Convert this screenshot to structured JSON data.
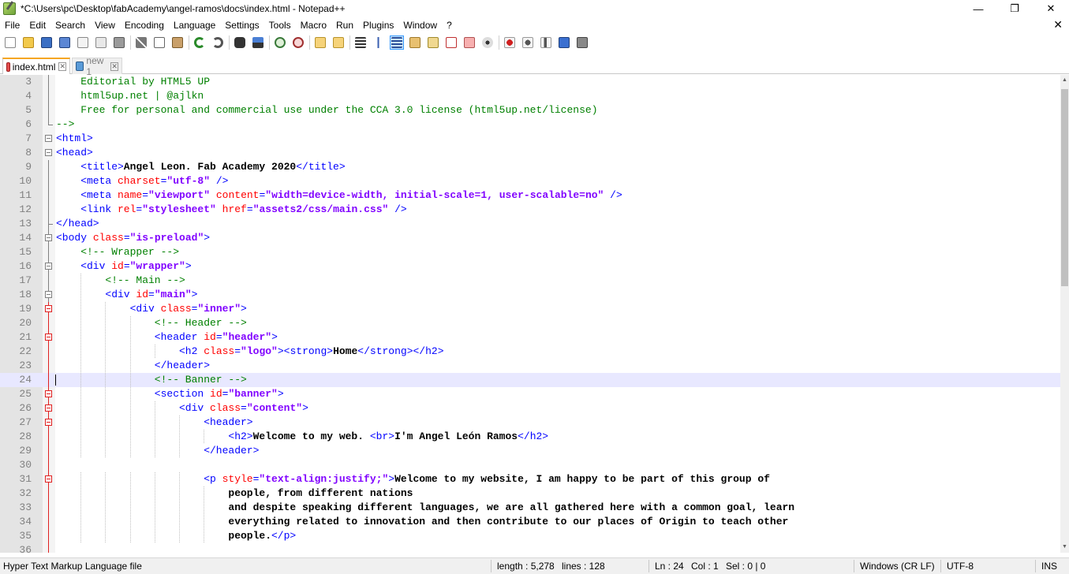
{
  "window": {
    "title": "*C:\\Users\\pc\\Desktop\\fabAcademy\\angel-ramos\\docs\\index.html - Notepad++",
    "minimize": "—",
    "maximize": "❐",
    "close": "✕"
  },
  "menu": {
    "items": [
      "File",
      "Edit",
      "Search",
      "View",
      "Encoding",
      "Language",
      "Settings",
      "Tools",
      "Macro",
      "Run",
      "Plugins",
      "Window",
      "?"
    ],
    "close_glyph": "✕"
  },
  "tabs": [
    {
      "label": "index.html",
      "close": "✕",
      "active": true
    },
    {
      "label": "new 1",
      "close": "✕",
      "active": false
    }
  ],
  "editor": {
    "current_line": 24,
    "lines": [
      {
        "n": 3,
        "indent": 4,
        "segs": [
          [
            "cm",
            "Editorial by HTML5 UP"
          ]
        ]
      },
      {
        "n": 4,
        "indent": 4,
        "segs": [
          [
            "cm",
            "html5up.net | @ajlkn"
          ]
        ]
      },
      {
        "n": 5,
        "indent": 4,
        "segs": [
          [
            "cm",
            "Free for personal and commercial use under the CCA 3.0 license (html5up.net/license)"
          ]
        ]
      },
      {
        "n": 6,
        "indent": 0,
        "segs": [
          [
            "cm",
            "-->"
          ]
        ]
      },
      {
        "n": 7,
        "indent": 0,
        "segs": [
          [
            "tg",
            "<html>"
          ]
        ]
      },
      {
        "n": 8,
        "indent": 0,
        "segs": [
          [
            "tg",
            "<head>"
          ]
        ]
      },
      {
        "n": 9,
        "indent": 4,
        "segs": [
          [
            "tg",
            "<title>"
          ],
          [
            "tx",
            "Angel Leon. Fab Academy 2020"
          ],
          [
            "tg",
            "</title>"
          ]
        ]
      },
      {
        "n": 10,
        "indent": 4,
        "segs": [
          [
            "tg",
            "<meta "
          ],
          [
            "at",
            "charset"
          ],
          [
            "tg",
            "="
          ],
          [
            "av",
            "\"utf-8\""
          ],
          [
            "tg",
            " />"
          ]
        ]
      },
      {
        "n": 11,
        "indent": 4,
        "segs": [
          [
            "tg",
            "<meta "
          ],
          [
            "at",
            "name"
          ],
          [
            "tg",
            "="
          ],
          [
            "av",
            "\"viewport\""
          ],
          [
            "tg",
            " "
          ],
          [
            "at",
            "content"
          ],
          [
            "tg",
            "="
          ],
          [
            "av",
            "\"width=device-width, initial-scale=1, user-scalable=no\""
          ],
          [
            "tg",
            " />"
          ]
        ]
      },
      {
        "n": 12,
        "indent": 4,
        "segs": [
          [
            "tg",
            "<link "
          ],
          [
            "at",
            "rel"
          ],
          [
            "tg",
            "="
          ],
          [
            "av",
            "\"stylesheet\""
          ],
          [
            "tg",
            " "
          ],
          [
            "at",
            "href"
          ],
          [
            "tg",
            "="
          ],
          [
            "av",
            "\"assets2/css/main.css\""
          ],
          [
            "tg",
            " />"
          ]
        ]
      },
      {
        "n": 13,
        "indent": 0,
        "segs": [
          [
            "tg",
            "</head>"
          ]
        ]
      },
      {
        "n": 14,
        "indent": 0,
        "segs": [
          [
            "tg",
            "<body "
          ],
          [
            "at",
            "class"
          ],
          [
            "tg",
            "="
          ],
          [
            "av",
            "\"is-preload\""
          ],
          [
            "tg",
            ">"
          ]
        ]
      },
      {
        "n": 15,
        "indent": 4,
        "segs": [
          [
            "cm",
            "<!-- Wrapper -->"
          ]
        ]
      },
      {
        "n": 16,
        "indent": 4,
        "segs": [
          [
            "tg",
            "<div "
          ],
          [
            "at",
            "id"
          ],
          [
            "tg",
            "="
          ],
          [
            "av",
            "\"wrapper\""
          ],
          [
            "tg",
            ">"
          ]
        ]
      },
      {
        "n": 17,
        "indent": 8,
        "segs": [
          [
            "cm",
            "<!-- Main -->"
          ]
        ]
      },
      {
        "n": 18,
        "indent": 8,
        "segs": [
          [
            "tg",
            "<div "
          ],
          [
            "at",
            "id"
          ],
          [
            "tg",
            "="
          ],
          [
            "av",
            "\"main\""
          ],
          [
            "tg",
            ">"
          ]
        ]
      },
      {
        "n": 19,
        "indent": 12,
        "segs": [
          [
            "tg",
            "<div "
          ],
          [
            "at",
            "class"
          ],
          [
            "tg",
            "="
          ],
          [
            "av",
            "\"inner\""
          ],
          [
            "tg",
            ">"
          ]
        ]
      },
      {
        "n": 20,
        "indent": 16,
        "segs": [
          [
            "cm",
            "<!-- Header -->"
          ]
        ]
      },
      {
        "n": 21,
        "indent": 16,
        "segs": [
          [
            "tg",
            "<header "
          ],
          [
            "at",
            "id"
          ],
          [
            "tg",
            "="
          ],
          [
            "av",
            "\"header\""
          ],
          [
            "tg",
            ">"
          ]
        ]
      },
      {
        "n": 22,
        "indent": 20,
        "segs": [
          [
            "tg",
            "<h2 "
          ],
          [
            "at",
            "class"
          ],
          [
            "tg",
            "="
          ],
          [
            "av",
            "\"logo\""
          ],
          [
            "tg",
            "><strong>"
          ],
          [
            "tx",
            "Home"
          ],
          [
            "tg",
            "</strong></h2>"
          ]
        ]
      },
      {
        "n": 23,
        "indent": 16,
        "segs": [
          [
            "tg",
            "</header>"
          ]
        ]
      },
      {
        "n": 24,
        "indent": 16,
        "segs": [
          [
            "cm",
            "<!-- Banner -->"
          ]
        ]
      },
      {
        "n": 25,
        "indent": 16,
        "segs": [
          [
            "tg",
            "<section "
          ],
          [
            "at",
            "id"
          ],
          [
            "tg",
            "="
          ],
          [
            "av",
            "\"banner\""
          ],
          [
            "tg",
            ">"
          ]
        ]
      },
      {
        "n": 26,
        "indent": 20,
        "segs": [
          [
            "tg",
            "<div "
          ],
          [
            "at",
            "class"
          ],
          [
            "tg",
            "="
          ],
          [
            "av",
            "\"content\""
          ],
          [
            "tg",
            ">"
          ]
        ]
      },
      {
        "n": 27,
        "indent": 24,
        "segs": [
          [
            "tg",
            "<header>"
          ]
        ]
      },
      {
        "n": 28,
        "indent": 28,
        "segs": [
          [
            "tg",
            "<h2>"
          ],
          [
            "tx",
            "Welcome to my web. "
          ],
          [
            "tg",
            "<br>"
          ],
          [
            "tx",
            "I'm Angel León Ramos"
          ],
          [
            "tg",
            "</h2>"
          ]
        ]
      },
      {
        "n": 29,
        "indent": 24,
        "segs": [
          [
            "tg",
            "</header>"
          ]
        ]
      },
      {
        "n": 30,
        "indent": 0,
        "segs": []
      },
      {
        "n": 31,
        "indent": 24,
        "segs": [
          [
            "tg",
            "<p "
          ],
          [
            "at",
            "style"
          ],
          [
            "tg",
            "="
          ],
          [
            "av",
            "\"text-align:justify;\""
          ],
          [
            "tg",
            ">"
          ],
          [
            "tx",
            "Welcome to my website, I am happy to be part of this group of"
          ]
        ]
      },
      {
        "n": 32,
        "indent": 28,
        "segs": [
          [
            "tx",
            "people, from different nations"
          ]
        ]
      },
      {
        "n": 33,
        "indent": 28,
        "segs": [
          [
            "tx",
            "and despite speaking different languages, we are all gathered here with a common goal, learn"
          ]
        ]
      },
      {
        "n": 34,
        "indent": 28,
        "segs": [
          [
            "tx",
            "everything related to innovation and then contribute to our places of Origin to teach other"
          ]
        ]
      },
      {
        "n": 35,
        "indent": 28,
        "segs": [
          [
            "tx",
            "people."
          ],
          [
            "tg",
            "</p>"
          ]
        ]
      },
      {
        "n": 36,
        "indent": 0,
        "segs": []
      }
    ]
  },
  "status": {
    "filetype": "Hyper Text Markup Language file",
    "length": "length : 5,278",
    "lines": "lines : 128",
    "ln": "Ln : 24",
    "col": "Col : 1",
    "sel": "Sel : 0 | 0",
    "eol": "Windows (CR LF)",
    "encoding": "UTF-8",
    "mode": "INS"
  },
  "colors": {
    "tag": "#0000ff",
    "attribute": "#ff0000",
    "attr_value": "#8000ff",
    "comment": "#008000",
    "text": "#000000",
    "current_line": "#e8e8ff"
  }
}
